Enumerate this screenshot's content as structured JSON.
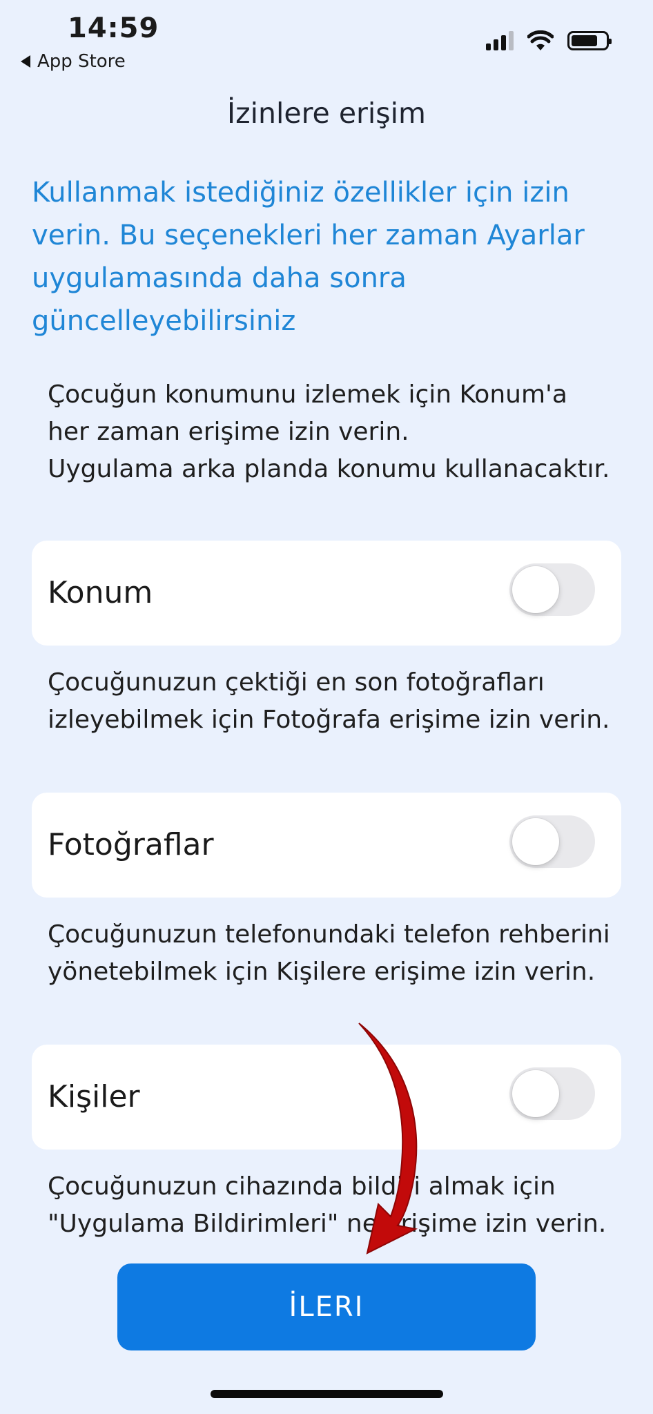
{
  "status_bar": {
    "time": "14:59",
    "back_label": "App Store",
    "icons": [
      "cellular-signal-icon",
      "wifi-icon",
      "battery-icon"
    ]
  },
  "page": {
    "title": "İzinlere erişim",
    "intro": "Kullanmak istediğiniz özellikler için izin verin. Bu seçenekleri her zaman Ayarlar uygulamasında daha sonra güncelleyebilirsiniz"
  },
  "permissions": [
    {
      "description": "Çocuğun konumunu izlemek için Konum'a her zaman erişime izin verin.\nUygulama arka planda konumu kullanacaktır.",
      "label": "Konum",
      "enabled": false
    },
    {
      "description": "Çocuğunuzun çektiği en son fotoğrafları izleyebilmek için Fotoğrafa erişime izin verin.",
      "label": "Fotoğraflar",
      "enabled": false
    },
    {
      "description": "Çocuğunuzun telefonundaki telefon rehberini yönetebilmek için Kişilere erişime izin verin.",
      "label": "Kişiler",
      "enabled": false
    },
    {
      "description": "Çocuğunuzun cihazında bildiri almak için \"Uygulama Bildirimleri\" ne erişime izin verin."
    }
  ],
  "footer": {
    "next_label": "İLERI"
  },
  "colors": {
    "background": "#eaf1fd",
    "accent_text": "#1f86d6",
    "button": "#0e7ae2",
    "annotation_arrow": "#c20a0a"
  }
}
